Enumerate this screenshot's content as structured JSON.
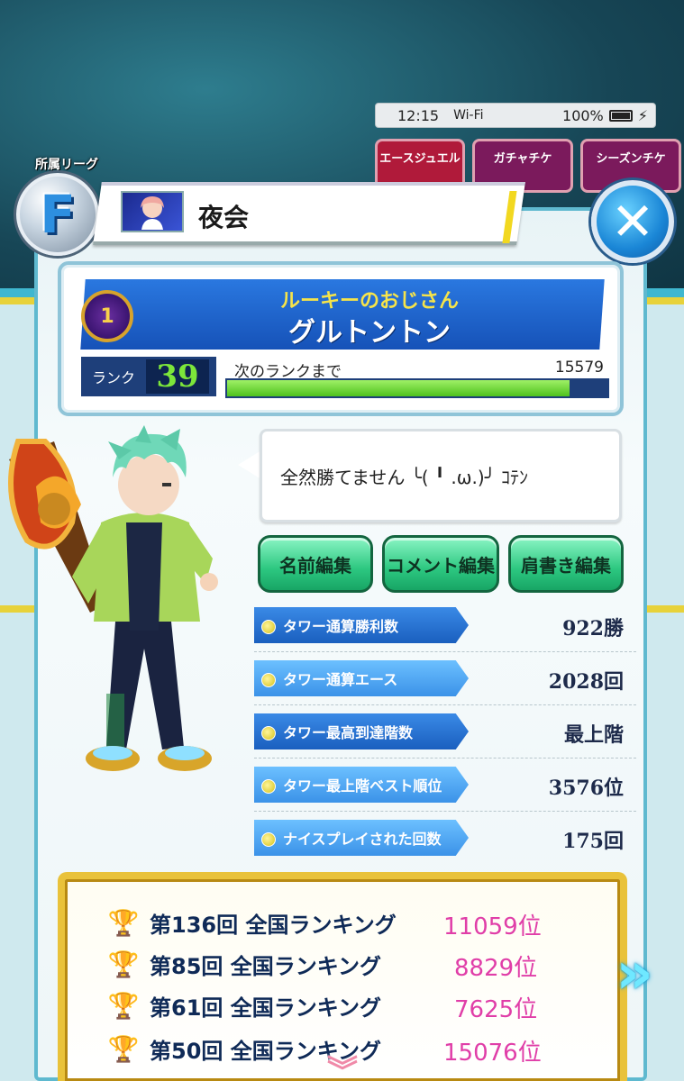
{
  "status_bar": {
    "time": "12:15",
    "network": "Wi-Fi",
    "battery": "100%"
  },
  "currencies": [
    {
      "label": "エースジュエル"
    },
    {
      "label": "ガチャチケ"
    },
    {
      "label": "シーズンチケ"
    }
  ],
  "league": {
    "label": "所属リーグ",
    "letter": "F"
  },
  "profile": {
    "name": "夜会",
    "title_sub": "ルーキーのおじさん",
    "title_main": "グルトントン",
    "rank_label": "ランク",
    "rank_value": "39",
    "next_rank_label": "次のランクまで",
    "next_rank_value": "15579",
    "progress": 0.9,
    "comment": "全然勝てません ╰( ╹ .ω.)╯ ｺﾃﾝ"
  },
  "buttons": {
    "edit_name": "名前編集",
    "edit_comment": "コメント編集",
    "edit_title": "肩書き編集",
    "close": "✕"
  },
  "stats": [
    {
      "label": "タワー通算勝利数",
      "value": "922勝"
    },
    {
      "label": "タワー通算エース",
      "value": "2028回"
    },
    {
      "label": "タワー最高到達階数",
      "value": "最上階"
    },
    {
      "label": "タワー最上階ベスト順位",
      "value": "3576位"
    },
    {
      "label": "ナイスプレイされた回数",
      "value": "175回"
    }
  ],
  "rankings": [
    {
      "title": "第136回  全国ランキング",
      "position": "11059位"
    },
    {
      "title": "第85回  全国ランキング",
      "position": "8829位"
    },
    {
      "title": "第61回  全国ランキング",
      "position": "7625位"
    },
    {
      "title": "第50回  全国ランキング",
      "position": "15076位"
    }
  ],
  "colors": {
    "accent_blue": "#1a5fbf",
    "button_green": "#2cc780",
    "rank_pink": "#e03ea8",
    "gold": "#e9c23a"
  },
  "icons": {
    "close": "close-icon",
    "trophy": "trophy-icon",
    "next": "chevron-right-icon",
    "scroll": "chevron-down-icon"
  }
}
